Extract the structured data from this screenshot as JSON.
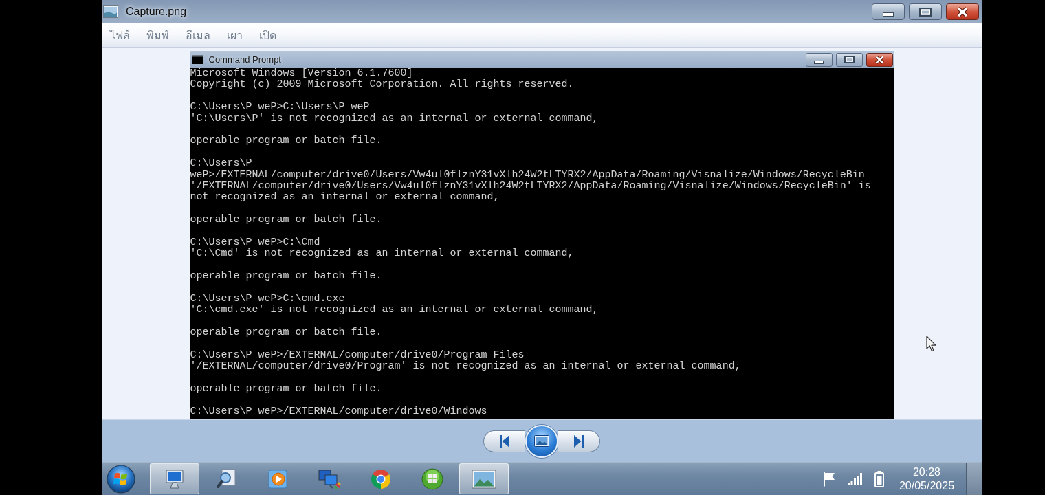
{
  "window": {
    "title": "Capture.png"
  },
  "menu": [
    "ไฟล์",
    "พิมพ์",
    "อีเมล",
    "เผา",
    "เปิด"
  ],
  "picture": {
    "title": "Command Prompt",
    "console_blocks": [
      [
        "Microsoft Windows [Version 6.1.7600]",
        "Copyright (c) 2009 Microsoft Corporation. All rights reserved."
      ],
      [
        "C:\\Users\\P weP>C:\\Users\\P weP",
        "'C:\\Users\\P' is not recognized as an internal or external command,"
      ],
      [
        "operable program or batch file."
      ],
      [
        "C:\\Users\\P",
        "weP>/EXTERNAL/computer/drive0/Users/Vw4ul0flznY31vXlh24W2tLTYRX2/AppData/Roaming/Visnalize/Windows/RecycleBin",
        "'/EXTERNAL/computer/drive0/Users/Vw4ul0flznY31vXlh24W2tLTYRX2/AppData/Roaming/Visnalize/Windows/RecycleBin' is",
        "not recognized as an internal or external command,"
      ],
      [
        "operable program or batch file."
      ],
      [
        "C:\\Users\\P weP>C:\\Cmd",
        "'C:\\Cmd' is not recognized as an internal or external command,"
      ],
      [
        "operable program or batch file."
      ],
      [
        "C:\\Users\\P weP>C:\\cmd.exe",
        "'C:\\cmd.exe' is not recognized as an internal or external command,"
      ],
      [
        "operable program or batch file."
      ],
      [
        "C:\\Users\\P weP>/EXTERNAL/computer/drive0/Program Files",
        "'/EXTERNAL/computer/drive0/Program' is not recognized as an internal or external command,"
      ],
      [
        "operable program or batch file."
      ],
      [
        "C:\\Users\\P weP>/EXTERNAL/computer/drive0/Windows"
      ]
    ]
  },
  "taskbar": {
    "items": [
      {
        "kind": "computer",
        "open": true
      },
      {
        "kind": "magnifier",
        "open": false
      },
      {
        "kind": "media",
        "open": false
      },
      {
        "kind": "network",
        "open": false
      },
      {
        "kind": "browser",
        "open": false
      },
      {
        "kind": "orb",
        "open": false
      },
      {
        "kind": "photo",
        "open": true
      }
    ],
    "clock": {
      "time": "20:28",
      "date": "20/05/2025"
    }
  }
}
